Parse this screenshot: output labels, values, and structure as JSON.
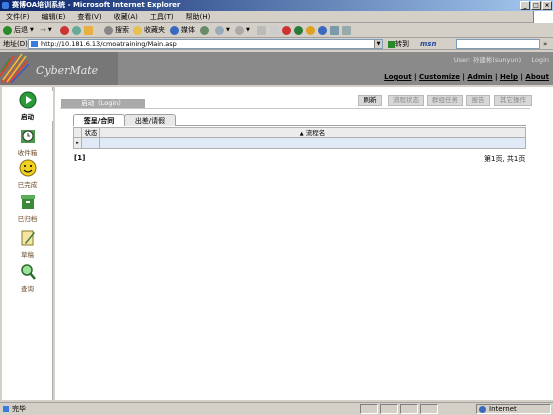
{
  "window": {
    "title": "赛博OA培训系统 - Microsoft Internet Explorer"
  },
  "menu": [
    "文件(F)",
    "编辑(E)",
    "查看(V)",
    "收藏(A)",
    "工具(T)",
    "帮助(H)"
  ],
  "toolbar": {
    "back": "后退",
    "search": "搜索",
    "favorites": "收藏夹",
    "media": "媒体"
  },
  "address": {
    "label": "地址(D)",
    "url": "http://10.181.6.13/cmoatraining/Main.asp",
    "go": "转到",
    "msn": "msn"
  },
  "header": {
    "logo_text": "CyberMate",
    "user_line": "User: 孙建彬(sunyun)",
    "login": "Login",
    "links": [
      "Logout",
      "Customize",
      "Admin",
      "Help",
      "About"
    ]
  },
  "sidebar": {
    "items": [
      {
        "label": "启动",
        "icon": "start-icon"
      },
      {
        "label": "收件箱",
        "icon": "inbox-clock-icon"
      },
      {
        "label": "已完成",
        "icon": "smiley-icon"
      },
      {
        "label": "已归档",
        "icon": "archive-icon"
      },
      {
        "label": "草稿",
        "icon": "draft-pencil-icon"
      },
      {
        "label": "查询",
        "icon": "magnifier-icon"
      }
    ]
  },
  "content": {
    "crumb": "启动（Login）",
    "buttons": [
      "刷新",
      "流程状态",
      "群组任务",
      "报告",
      "其它操作"
    ],
    "tabs": [
      "签呈/合同",
      "出差/请假"
    ],
    "grid": {
      "columns": [
        "状态",
        "流程名"
      ]
    },
    "page_index": "[1]",
    "page_info": "第1页, 共1页"
  },
  "status": {
    "left": "完毕",
    "zone": "Internet"
  }
}
